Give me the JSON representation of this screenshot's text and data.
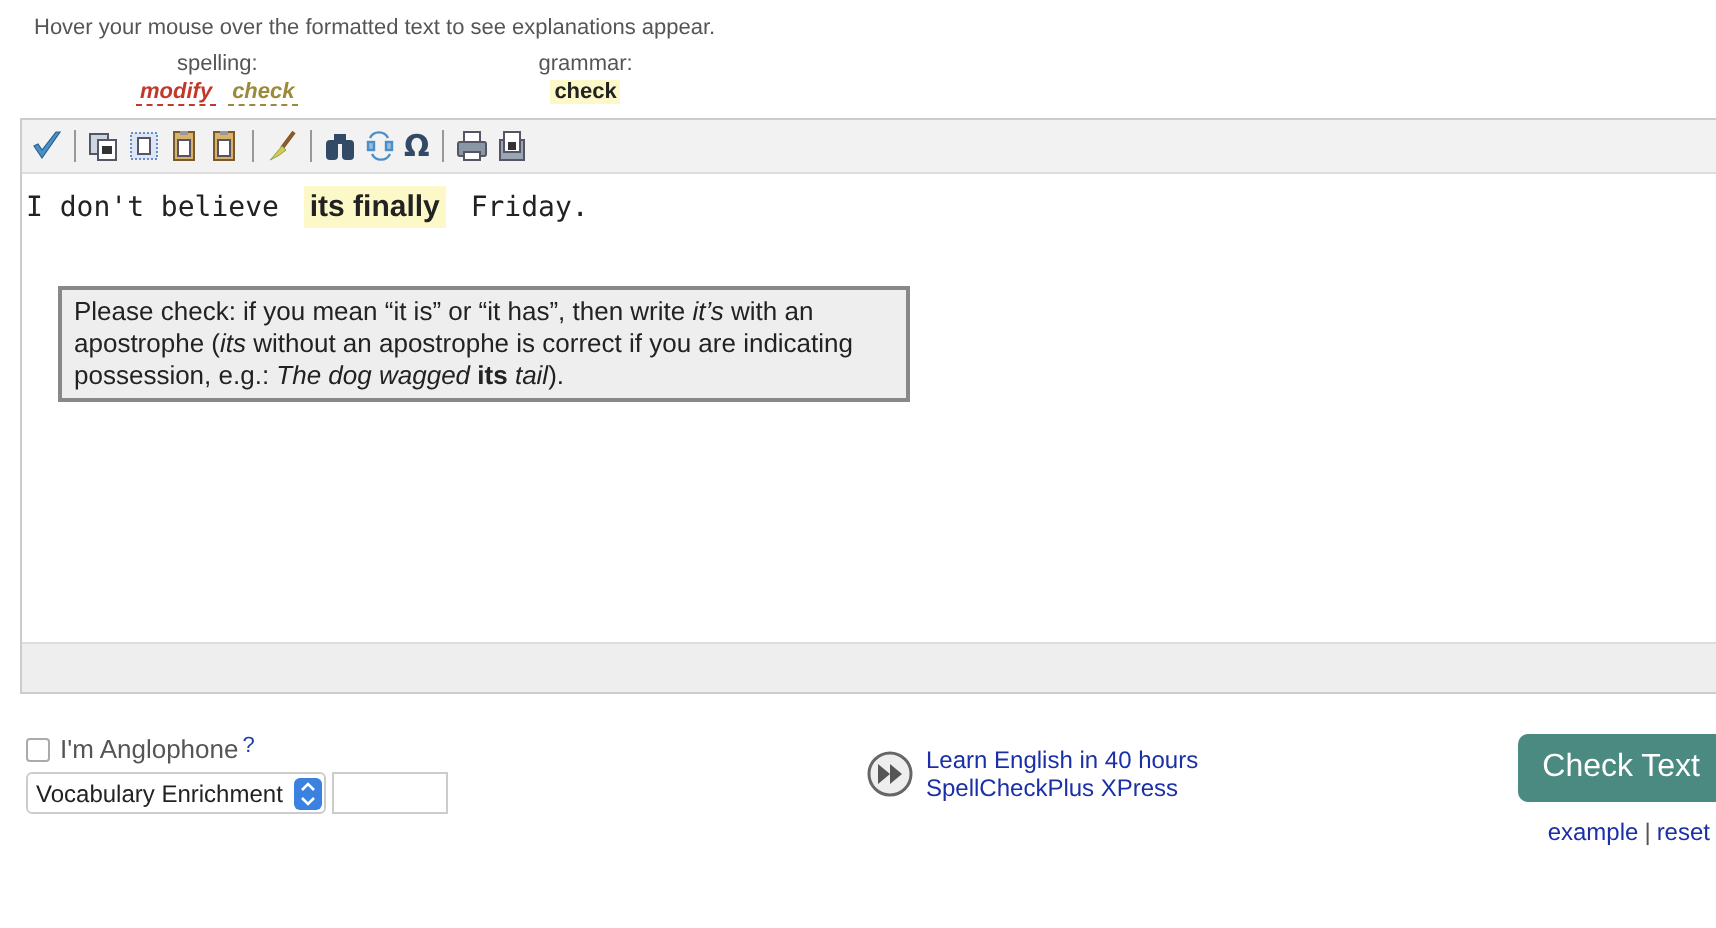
{
  "hint": "Hover your mouse over the formatted text to see explanations appear.",
  "legend": [
    {
      "heading": "spelling:",
      "items": [
        {
          "label": "modify",
          "kind": "spelling-modify"
        },
        {
          "label": "check",
          "kind": "spelling-check"
        }
      ]
    },
    {
      "heading": "grammar:",
      "items": [
        {
          "label": "check",
          "kind": "grammar-check"
        }
      ]
    }
  ],
  "toolbar": [
    [
      {
        "kind": "checkmark"
      }
    ],
    [
      {
        "kind": "copy"
      },
      {
        "kind": "paste-text"
      },
      {
        "kind": "paste"
      },
      {
        "kind": "paste-word"
      }
    ],
    [
      {
        "kind": "brush"
      }
    ],
    [
      {
        "kind": "binoculars"
      },
      {
        "kind": "replace"
      },
      {
        "kind": "glyph",
        "label": "Ω"
      }
    ],
    [
      {
        "kind": "printer"
      },
      {
        "kind": "document"
      }
    ]
  ],
  "editor": {
    "segments": [
      {
        "text": "I don't believe ",
        "kind": "plain"
      },
      {
        "text": "its finally",
        "kind": "grammar"
      },
      {
        "text": " Friday.",
        "kind": "plain"
      }
    ],
    "tooltip": "Please check: if you mean “it is” or “it has”, then write *it’s* with an apostrophe (*its* without an apostrophe is correct if you are indicating possession, e.g.: *The dog wagged* **its** *tail*)."
  },
  "anglophone": {
    "label": "I'm Anglophone",
    "help": "?",
    "checked": false
  },
  "mode_select": {
    "value": "Vocabulary Enrichment"
  },
  "promo": {
    "lines": [
      "Learn English in 40 hours",
      "SpellCheckPlus XPress"
    ]
  },
  "check_button": "Check Text",
  "links": [
    "example",
    "reset"
  ],
  "link_separator": "|"
}
